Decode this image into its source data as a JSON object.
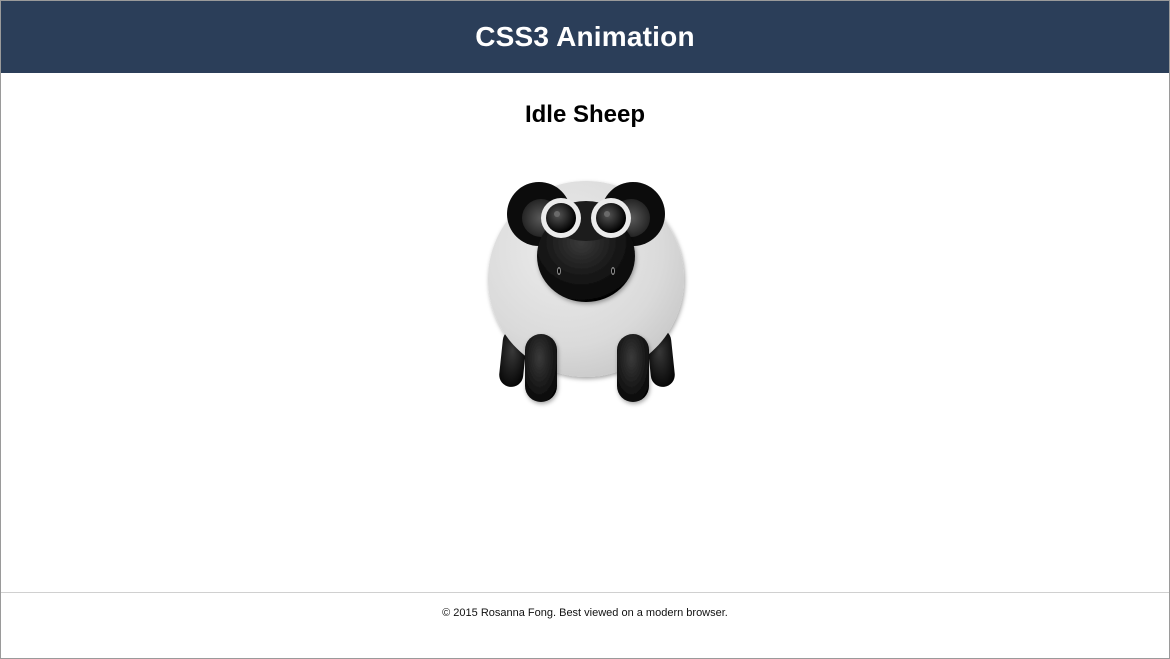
{
  "header": {
    "title": "CSS3 Animation"
  },
  "main": {
    "subtitle": "Idle Sheep",
    "illustration": {
      "subject": "sheep",
      "body_color": "#dcdcdc",
      "head_color": "#111111",
      "eye_ring_color": "#e6e6e6"
    }
  },
  "footer": {
    "text": "© 2015 Rosanna Fong. Best viewed on a modern browser."
  },
  "colors": {
    "header_bg": "#2b3e59",
    "header_text": "#ffffff",
    "page_bg": "#ffffff"
  }
}
